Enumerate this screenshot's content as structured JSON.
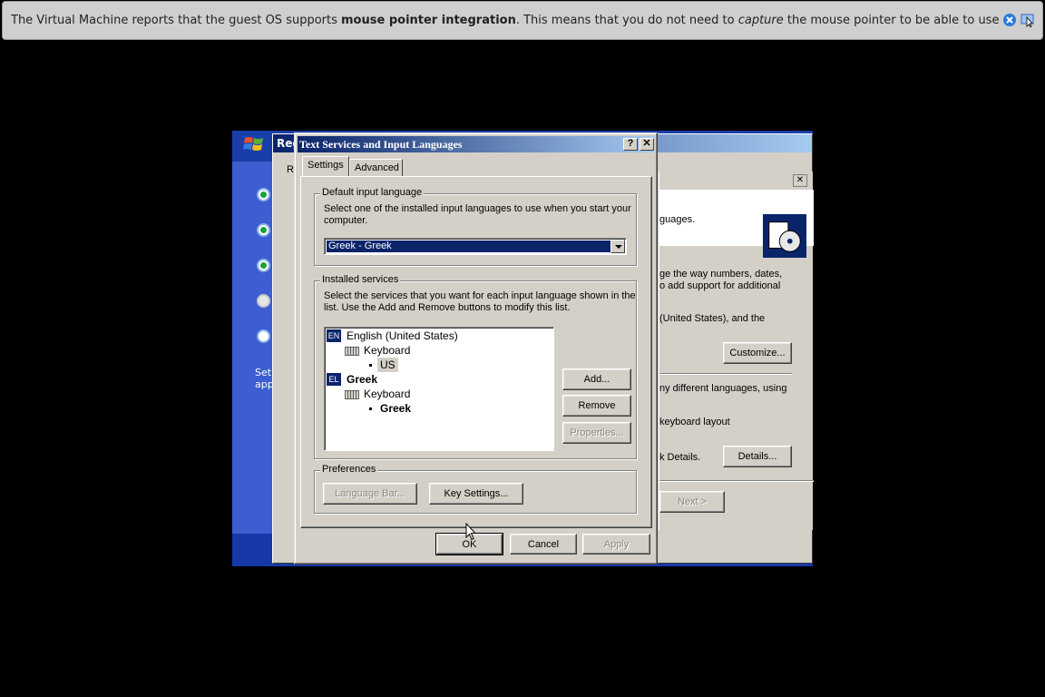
{
  "vm_notice": {
    "prefix": "The Virtual Machine reports that the guest OS supports ",
    "bold": "mouse pointer integration",
    "mid": ". This means that you do not need to ",
    "italic": "capture",
    "suffix": " the mouse pointer to be able to use it in your guest OS --"
  },
  "setup": {
    "side_text": "Setup app"
  },
  "back_dialog": {
    "title": "Reg",
    "tab_initial": "R",
    "lines": [
      "guages.",
      "ge the way numbers, dates,",
      "o add support for additional",
      "(United States), and the",
      "ny different languages, using",
      " keyboard layout",
      "k Details."
    ],
    "customize_label": "Customize...",
    "details_label": "Details...",
    "next_label": "Next >"
  },
  "dialog": {
    "title": "Text Services and Input Languages",
    "help_label": "?",
    "close_label": "✕",
    "tabs": [
      {
        "label": "Settings"
      },
      {
        "label": "Advanced"
      }
    ],
    "default_group": {
      "label": "Default input language",
      "description_line1": "Select one of the installed input languages to use when you start your",
      "description_line2": "computer.",
      "selected_value": "Greek - Greek"
    },
    "installed_group": {
      "label": "Installed services",
      "description_line1": "Select the services that you want for each input language shown in the",
      "description_line2": "list. Use the Add and Remove buttons to modify this list.",
      "tree": [
        {
          "badge": "EN",
          "language": "English (United States)",
          "category": "Keyboard",
          "layout": "US"
        },
        {
          "badge": "EL",
          "language": "Greek",
          "category": "Keyboard",
          "layout": "Greek"
        }
      ],
      "add_label": "Add...",
      "remove_label": "Remove",
      "properties_label": "Properties..."
    },
    "preferences_group": {
      "label": "Preferences",
      "language_bar_label": "Language Bar...",
      "key_settings_label": "Key Settings..."
    },
    "ok_label": "OK",
    "cancel_label": "Cancel",
    "apply_label": "Apply"
  },
  "colors": {
    "titlebar_start": "#0a246a",
    "titlebar_end": "#a6caf0",
    "dialog_face": "#d4d0c8",
    "setup_blue": "#2a4ab6"
  }
}
